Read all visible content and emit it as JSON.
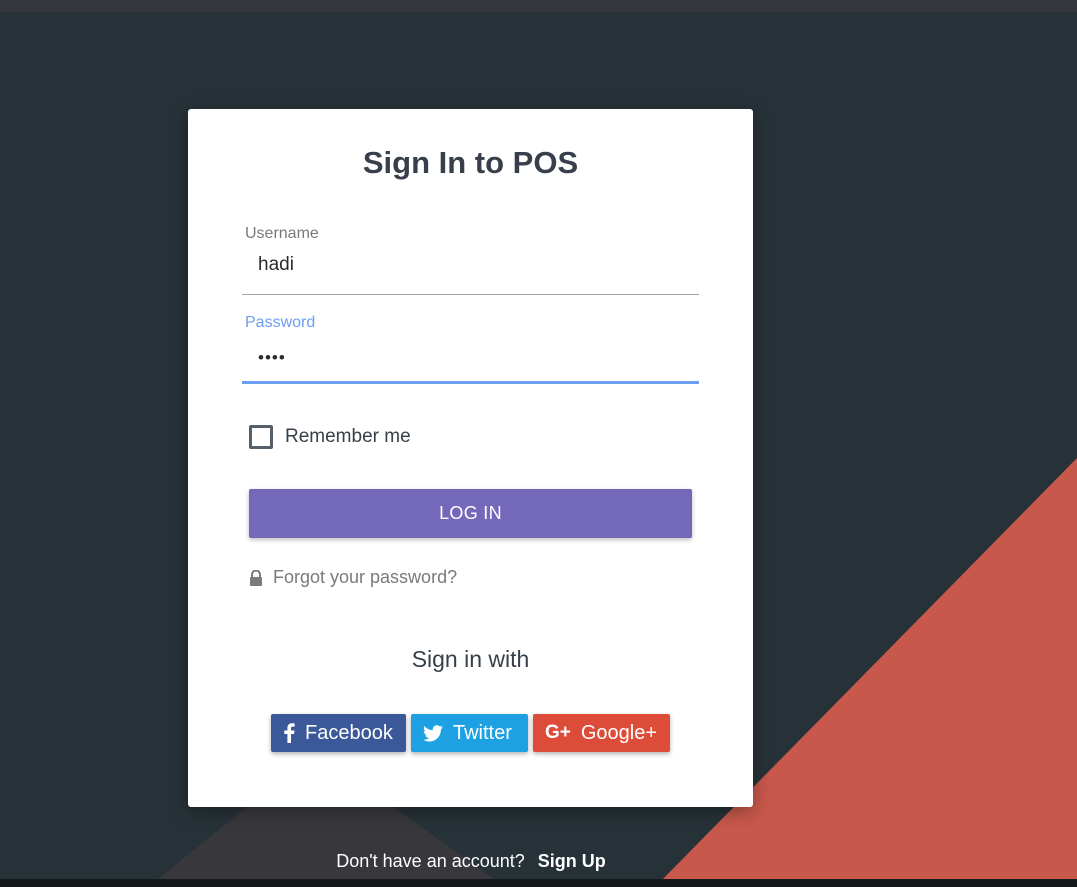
{
  "page": {
    "title_prefix": "Sign In to",
    "title_brand": "POS"
  },
  "form": {
    "username_label": "Username",
    "username_value": "hadi",
    "password_label": "Password",
    "password_value": "••••",
    "remember_label": "Remember me",
    "remember_checked": false,
    "login_label": "LOG IN",
    "forgot_label": "Forgot your password?"
  },
  "social": {
    "heading": "Sign in with",
    "facebook_label": "Facebook",
    "twitter_label": "Twitter",
    "google_label": "Google+"
  },
  "footer": {
    "prompt": "Don't have an account?",
    "signup_label": "Sign Up"
  },
  "colors": {
    "background": "#273238",
    "accent_red": "#c8584b",
    "primary": "#7468ba",
    "focus": "#6c9ef2",
    "facebook": "#3b5998",
    "twitter": "#1da1e2",
    "google": "#dd4b39"
  },
  "icons": {
    "lock": "lock-icon",
    "facebook": "facebook-icon",
    "twitter": "twitter-icon",
    "google": "google-plus-icon"
  }
}
